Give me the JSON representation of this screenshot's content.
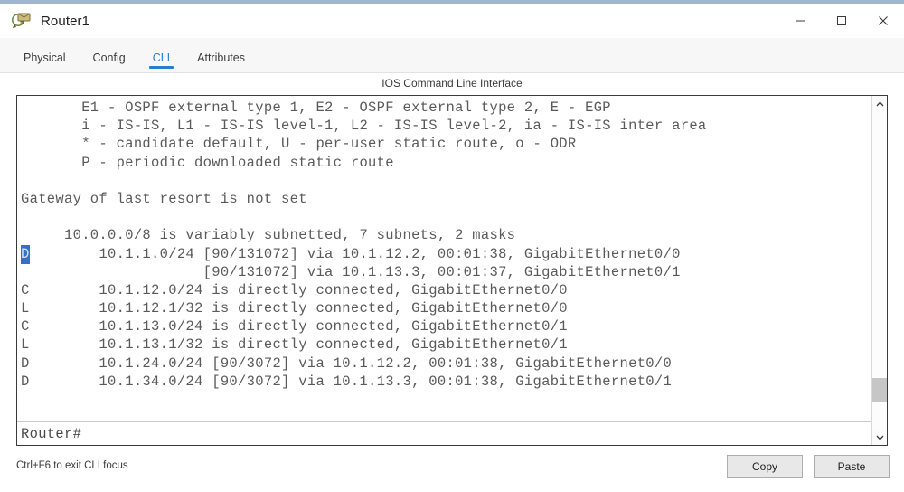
{
  "window": {
    "title": "Router1",
    "icon": "packet-tracer-router-icon",
    "accent_color": "#9fb6ce",
    "controls": [
      {
        "name": "minimize",
        "glyph": "minimize-icon"
      },
      {
        "name": "maximize",
        "glyph": "maximize-icon"
      },
      {
        "name": "close",
        "glyph": "close-icon"
      }
    ]
  },
  "tabs": {
    "active": "CLI",
    "active_color": "#2b7cd3",
    "items": [
      {
        "label": "Physical"
      },
      {
        "label": "Config"
      },
      {
        "label": "CLI"
      },
      {
        "label": "Attributes"
      }
    ]
  },
  "cli": {
    "caption": "IOS Command Line Interface",
    "selection_color": "#3370c8",
    "selected_text": "D",
    "prompt": "Router#",
    "lines": [
      {
        "text": "       E1 - OSPF external type 1, E2 - OSPF external type 2, E - EGP"
      },
      {
        "text": "       i - IS-IS, L1 - IS-IS level-1, L2 - IS-IS level-2, ia - IS-IS inter area"
      },
      {
        "text": "       * - candidate default, U - per-user static route, o - ODR"
      },
      {
        "text": "       P - periodic downloaded static route"
      },
      {
        "text": ""
      },
      {
        "text": "Gateway of last resort is not set"
      },
      {
        "text": ""
      },
      {
        "text": "     10.0.0.0/8 is variably subnetted, 7 subnets, 2 masks"
      },
      {
        "selected": "D",
        "after": "        10.1.1.0/24 [90/131072] via 10.1.12.2, 00:01:38, GigabitEthernet0/0"
      },
      {
        "text": "                     [90/131072] via 10.1.13.3, 00:01:37, GigabitEthernet0/1"
      },
      {
        "text": "C        10.1.12.0/24 is directly connected, GigabitEthernet0/0"
      },
      {
        "text": "L        10.1.12.1/32 is directly connected, GigabitEthernet0/0"
      },
      {
        "text": "C        10.1.13.0/24 is directly connected, GigabitEthernet0/1"
      },
      {
        "text": "L        10.1.13.1/32 is directly connected, GigabitEthernet0/1"
      },
      {
        "text": "D        10.1.24.0/24 [90/3072] via 10.1.12.2, 00:01:38, GigabitEthernet0/0"
      },
      {
        "text": "D        10.1.34.0/24 [90/3072] via 10.1.13.3, 00:01:38, GigabitEthernet0/1"
      }
    ]
  },
  "scrollbar": {
    "up_arrow": "chevron-up-icon",
    "down_arrow": "chevron-down-icon"
  },
  "footer": {
    "hint": "Ctrl+F6 to exit CLI focus",
    "copy_label": "Copy",
    "paste_label": "Paste"
  }
}
